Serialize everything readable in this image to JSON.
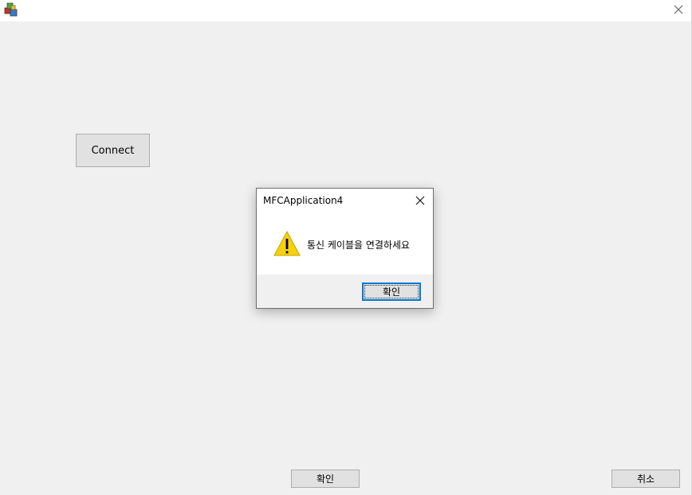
{
  "window": {
    "close_glyph": "✕"
  },
  "main": {
    "connect_label": "Connect",
    "ok_label": "확인",
    "cancel_label": "취소"
  },
  "dialog": {
    "title": "MFCApplication4",
    "message": "통신 케이블을 연결하세요",
    "ok_label": "확인",
    "icon": "warning-icon",
    "accent": "#0078d7"
  },
  "colors": {
    "background": "#f0f0f0",
    "titlebar": "#ffffff",
    "button_face": "#e1e1e1",
    "warning_yellow": "#f6d10e"
  }
}
